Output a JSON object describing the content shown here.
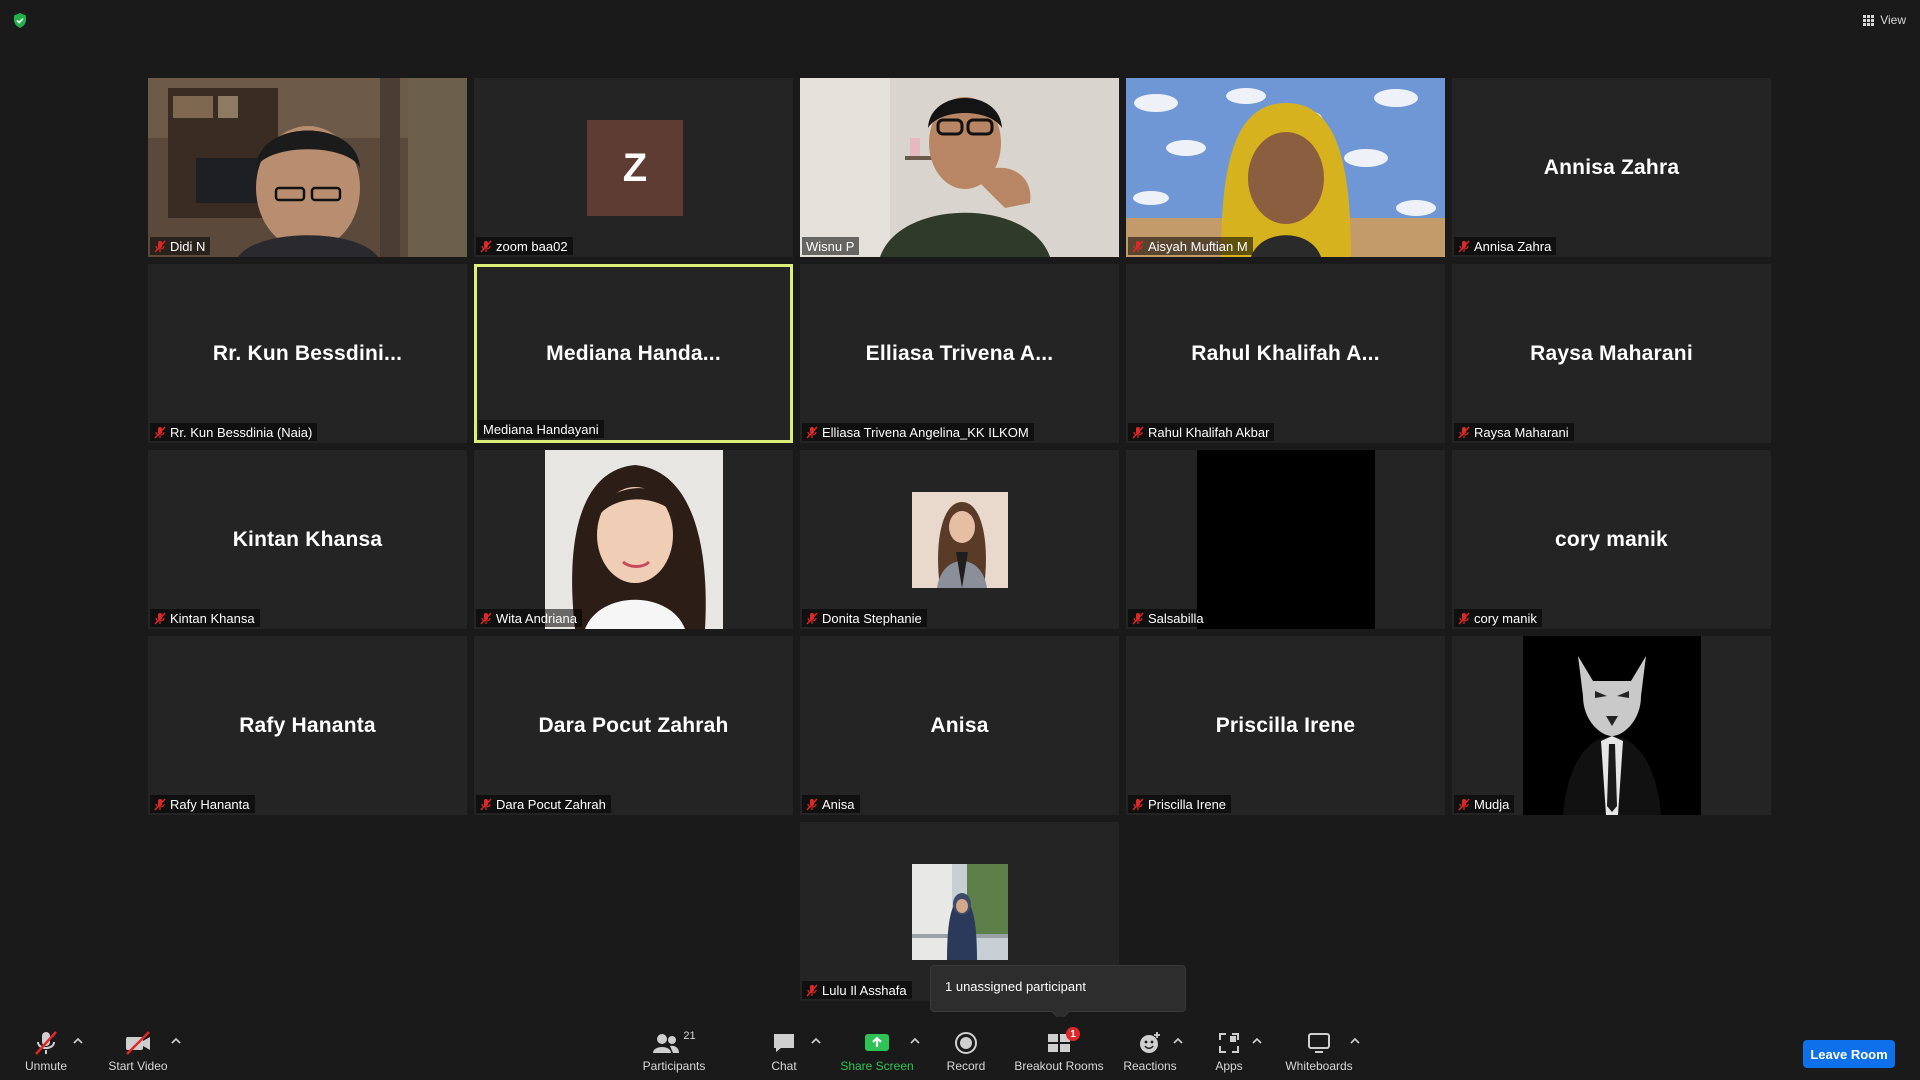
{
  "top_bar": {
    "security_icon": "shield-check-icon",
    "view_label": "View"
  },
  "tiles": [
    {
      "id": "didi",
      "label": "Didi N",
      "muted": true,
      "type": "video"
    },
    {
      "id": "zoom",
      "label": "zoom baa02",
      "muted": true,
      "type": "avatar",
      "avatar_letter": "Z",
      "avatar_color": "#5e3b33"
    },
    {
      "id": "wisnu",
      "label": "Wisnu P",
      "muted": false,
      "type": "video"
    },
    {
      "id": "aisyah",
      "label": "Aisyah Muftian M",
      "muted": true,
      "type": "video"
    },
    {
      "id": "annisa",
      "label": "Annisa Zahra",
      "muted": true,
      "type": "name",
      "display_name": "Annisa Zahra"
    },
    {
      "id": "kun",
      "label": "Rr. Kun Bessdinia (Naia)",
      "muted": true,
      "type": "name",
      "display_name": "Rr. Kun Bessdini..."
    },
    {
      "id": "mediana",
      "label": "Mediana Handayani",
      "muted": false,
      "type": "name",
      "display_name": "Mediana Handa...",
      "active_speaker": true
    },
    {
      "id": "elliasa",
      "label": "Elliasa Trivena Angelina_KK ILKOM",
      "muted": true,
      "type": "name",
      "display_name": "Elliasa Trivena A..."
    },
    {
      "id": "rahul",
      "label": "Rahul Khalifah Akbar",
      "muted": true,
      "type": "name",
      "display_name": "Rahul Khalifah A..."
    },
    {
      "id": "raysa",
      "label": "Raysa Maharani",
      "muted": true,
      "type": "name",
      "display_name": "Raysa Maharani"
    },
    {
      "id": "kintan",
      "label": "Kintan Khansa",
      "muted": true,
      "type": "name",
      "display_name": "Kintan Khansa"
    },
    {
      "id": "wita",
      "label": "Wita Andriana",
      "muted": true,
      "type": "photo"
    },
    {
      "id": "donita",
      "label": "Donita Stephanie",
      "muted": true,
      "type": "photo-small"
    },
    {
      "id": "salsabilla",
      "label": "Salsabilla",
      "muted": true,
      "type": "black"
    },
    {
      "id": "cory",
      "label": "cory manik",
      "muted": true,
      "type": "name",
      "display_name": "cory manik"
    },
    {
      "id": "rafy",
      "label": "Rafy Hananta",
      "muted": true,
      "type": "name",
      "display_name": "Rafy Hananta"
    },
    {
      "id": "dara",
      "label": "Dara Pocut Zahrah",
      "muted": true,
      "type": "name",
      "display_name": "Dara Pocut Zahrah"
    },
    {
      "id": "anisa",
      "label": "Anisa",
      "muted": true,
      "type": "name",
      "display_name": "Anisa"
    },
    {
      "id": "priscilla",
      "label": "Priscilla Irene",
      "muted": true,
      "type": "name",
      "display_name": "Priscilla Irene"
    },
    {
      "id": "mudja",
      "label": "Mudja",
      "muted": true,
      "type": "photo"
    },
    {
      "id": "lulu",
      "label": "Lulu Il Asshafa",
      "muted": true,
      "type": "photo-small"
    }
  ],
  "tooltip": {
    "text": "1 unassigned participant"
  },
  "toolbar": {
    "unmute": "Unmute",
    "start_video": "Start Video",
    "participants": "Participants",
    "participants_count": "21",
    "chat": "Chat",
    "share_screen": "Share Screen",
    "record": "Record",
    "breakout_rooms": "Breakout Rooms",
    "breakout_badge": "1",
    "reactions": "Reactions",
    "apps": "Apps",
    "whiteboards": "Whiteboards",
    "leave_room": "Leave Room"
  },
  "colors": {
    "background": "#1a1a1a",
    "tile": "#242424",
    "active_speaker": "#dcef7a",
    "mute_red": "#e02828",
    "share_green": "#2ec455",
    "leave_blue": "#0e71eb"
  }
}
